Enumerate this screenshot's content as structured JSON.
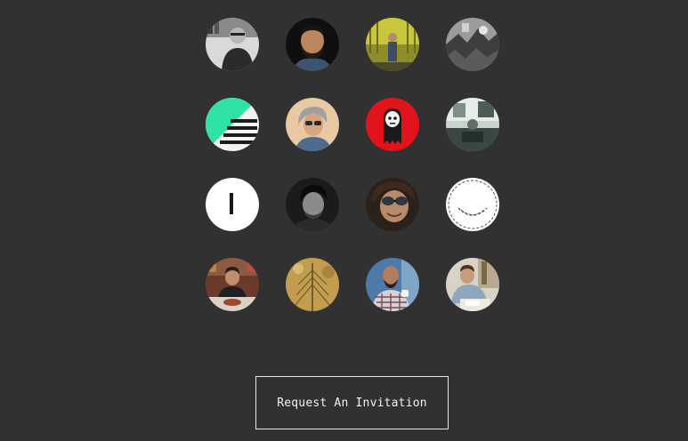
{
  "avatars": [
    {
      "id": "avatar-1",
      "kind": "photo-grayscale-man-glasses"
    },
    {
      "id": "avatar-2",
      "kind": "photo-bearded-man"
    },
    {
      "id": "avatar-3",
      "kind": "photo-yellow-background-person"
    },
    {
      "id": "avatar-4",
      "kind": "photo-grayscale-abstract"
    },
    {
      "id": "avatar-5",
      "kind": "graphic-mint-diagonal-poster"
    },
    {
      "id": "avatar-6",
      "kind": "photo-woman-sunglasses"
    },
    {
      "id": "avatar-7",
      "kind": "graphic-red-cartoon-ghost"
    },
    {
      "id": "avatar-8",
      "kind": "photo-room-interior"
    },
    {
      "id": "avatar-9",
      "kind": "logo-white-vertical-bar"
    },
    {
      "id": "avatar-10",
      "kind": "photo-grayscale-man"
    },
    {
      "id": "avatar-11",
      "kind": "photo-man-sunglasses-selfie"
    },
    {
      "id": "avatar-12",
      "kind": "logo-dashed-smile"
    },
    {
      "id": "avatar-13",
      "kind": "photo-man-dining"
    },
    {
      "id": "avatar-14",
      "kind": "photo-golden-tree"
    },
    {
      "id": "avatar-15",
      "kind": "photo-bald-man-plaid-shirt"
    },
    {
      "id": "avatar-16",
      "kind": "photo-man-writing"
    }
  ],
  "cta": {
    "label": "Request An Invitation"
  },
  "colors": {
    "background": "#323131",
    "button_border": "#e8e8e8",
    "button_text": "#f2f2f2",
    "mint": "#2fe3a5",
    "red": "#e3131c"
  }
}
